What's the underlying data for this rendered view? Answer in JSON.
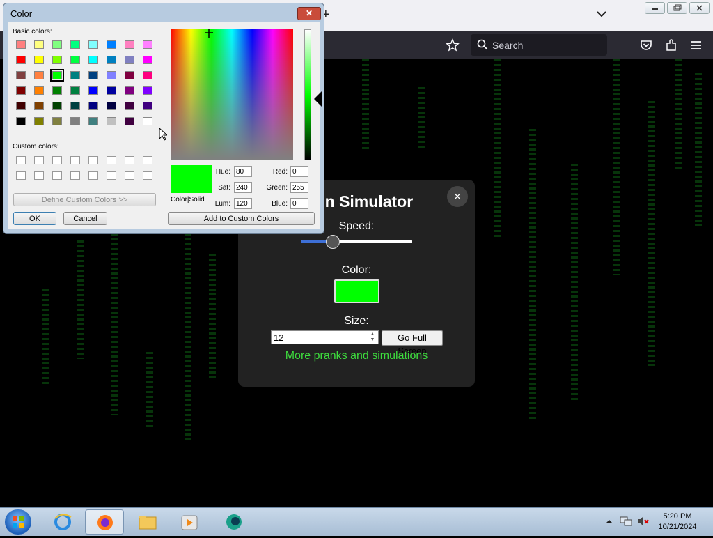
{
  "browser": {
    "search_placeholder": "Search",
    "new_tab_glyph": "+"
  },
  "dialog": {
    "title": "Color",
    "close_glyph": "✕",
    "basic_colors_label": "Basic colors:",
    "custom_colors_label": "Custom colors:",
    "define_custom_label": "Define Custom Colors >>",
    "ok_label": "OK",
    "cancel_label": "Cancel",
    "add_custom_label": "Add to Custom Colors",
    "color_solid_label": "Color|Solid",
    "basic_colors": [
      "#ff8080",
      "#ffff80",
      "#80ff80",
      "#00ff80",
      "#80ffff",
      "#0080ff",
      "#ff80c0",
      "#ff80ff",
      "#ff0000",
      "#ffff00",
      "#80ff00",
      "#00ff40",
      "#00ffff",
      "#0080c0",
      "#8080c0",
      "#ff00ff",
      "#804040",
      "#ff8040",
      "#00ff00",
      "#008080",
      "#004080",
      "#8080ff",
      "#800040",
      "#ff0080",
      "#800000",
      "#ff8000",
      "#008000",
      "#008040",
      "#0000ff",
      "#0000a0",
      "#800080",
      "#8000ff",
      "#400000",
      "#804000",
      "#004000",
      "#004040",
      "#000080",
      "#000040",
      "#400040",
      "#400080",
      "#000000",
      "#808000",
      "#808040",
      "#808080",
      "#408080",
      "#c0c0c0",
      "#400040",
      "#ffffff"
    ],
    "selected_index": 18,
    "fields": {
      "hue_label": "Hue:",
      "hue": "80",
      "sat_label": "Sat:",
      "sat": "240",
      "lum_label": "Lum:",
      "lum": "120",
      "red_label": "Red:",
      "red": "0",
      "green_label": "Green:",
      "green": "255",
      "blue_label": "Blue:",
      "blue": "0"
    },
    "current_color": "#00ff00"
  },
  "panel": {
    "title": "Rain Simulator",
    "close_glyph": "×",
    "speed_label": "Speed:",
    "speed_fraction": 0.29,
    "color_label": "Color:",
    "color_value": "#00ff00",
    "size_label": "Size:",
    "size_value": "12",
    "fullscreen_label": "Go Full Screen",
    "more_link": "More pranks and simulations"
  },
  "taskbar": {
    "time": "5:20 PM",
    "date": "10/21/2024"
  },
  "colors": {
    "matrix_green": "#0d5e12",
    "toolbar": "#2b2a33",
    "link_green": "#3ddc3d"
  }
}
